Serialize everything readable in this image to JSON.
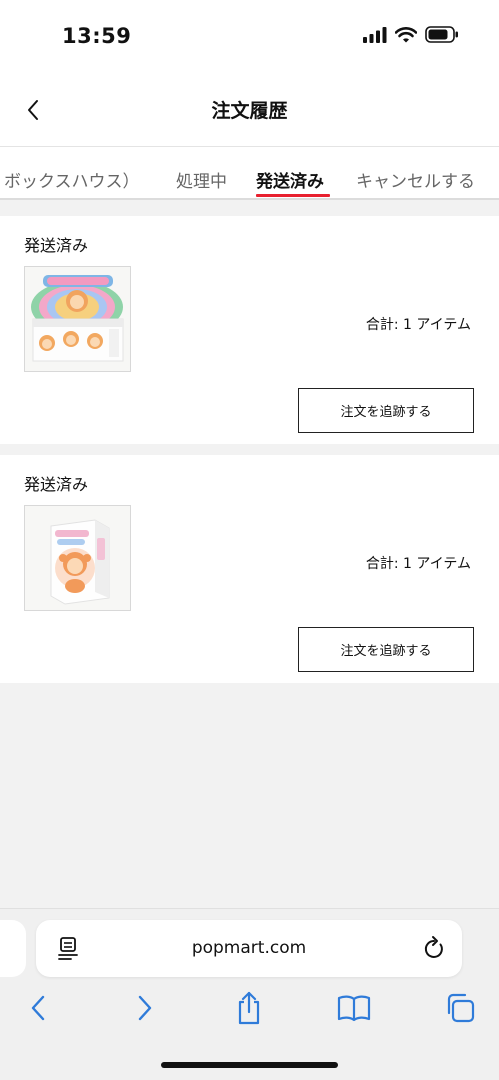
{
  "status_bar": {
    "time": "13:59"
  },
  "header": {
    "title": "注文履歴"
  },
  "tabs": [
    {
      "label": "ボックスハウス）",
      "active": false
    },
    {
      "label": "処理中",
      "active": false
    },
    {
      "label": "発送済み",
      "active": true
    },
    {
      "label": "キャンセルする",
      "active": false
    }
  ],
  "orders": [
    {
      "status": "発送済み",
      "total": "合計: 1 アイテム",
      "track_label": "注文を追跡する"
    },
    {
      "status": "発送済み",
      "total": "合計: 1 アイテム",
      "track_label": "注文を追跡する"
    }
  ],
  "browser": {
    "url": "popmart.com"
  },
  "colors": {
    "accent": "#e8202f",
    "link_blue": "#2f7bd9"
  },
  "icons": [
    "back-chevron-icon",
    "signal-icon",
    "wifi-icon",
    "battery-icon",
    "reader-icon",
    "reload-icon",
    "back-icon",
    "forward-icon",
    "share-icon",
    "bookmarks-icon",
    "tabs-icon"
  ]
}
